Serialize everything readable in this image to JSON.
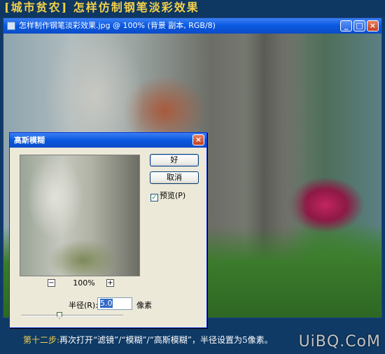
{
  "header": {
    "title": "[城市贫农]  怎样仿制钢笔淡彩效果"
  },
  "window": {
    "title": "怎样制作钢笔淡彩效果.jpg @ 100% (背景 副本, RGB/8)",
    "buttons": {
      "minimize": "_",
      "maximize": "□",
      "close": "×"
    }
  },
  "dialog": {
    "title": "高斯模糊",
    "ok_label": "好",
    "cancel_label": "取消",
    "preview_label": "预览(P)",
    "preview_checked": true,
    "zoom_minus": "−",
    "zoom_plus": "+",
    "zoom_value": "100%",
    "radius_label": "半径(R):",
    "radius_value": "5.0",
    "radius_unit": "像素"
  },
  "caption": {
    "step": "第十二步:",
    "text": "再次打开“滤镜”/“模糊”/“高斯模糊”，半径设置为5像素。"
  },
  "watermark": "UiBQ.CoM"
}
